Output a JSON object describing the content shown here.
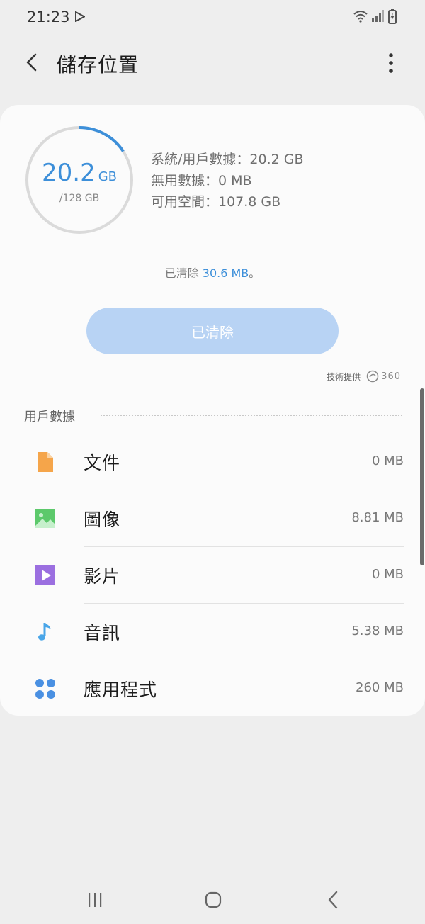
{
  "status_bar": {
    "time": "21:23",
    "icons": [
      "play-store-icon",
      "wifi-icon",
      "signal-icon",
      "battery-icon"
    ]
  },
  "header": {
    "back_icon": "chevron-left-icon",
    "title": "儲存位置",
    "menu_icon": "more-vert-icon"
  },
  "storage": {
    "used_value": "20.2",
    "used_unit": "GB",
    "total": "/128 GB",
    "used_fraction": 0.158,
    "stats": [
      "系統/用戶數據：20.2 GB",
      "無用數據：0 MB",
      "可用空間：107.8 GB"
    ]
  },
  "cleanup": {
    "message_prefix": "已清除 ",
    "message_amount": "30.6 MB",
    "message_suffix": "。",
    "button_label": "已清除",
    "powered_by": "技術提供",
    "provider": "360"
  },
  "user_data": {
    "section_title": "用戶數據",
    "items": [
      {
        "label": "文件",
        "size": "0 MB",
        "icon": "document-icon"
      },
      {
        "label": "圖像",
        "size": "8.81 MB",
        "icon": "image-icon"
      },
      {
        "label": "影片",
        "size": "0 MB",
        "icon": "video-icon"
      },
      {
        "label": "音訊",
        "size": "5.38 MB",
        "icon": "music-note-icon"
      },
      {
        "label": "應用程式",
        "size": "260 MB",
        "icon": "apps-icon"
      }
    ]
  },
  "colors": {
    "accent": "#3d8fd9",
    "button": "#b8d3f4",
    "document": "#f5a54a",
    "image": "#5cc96b",
    "video": "#9b6fe0",
    "audio": "#4aa6e8",
    "apps": "#4a90e2"
  },
  "nav_bar": {
    "icons": [
      "recent-apps-icon",
      "home-icon",
      "back-icon"
    ]
  }
}
